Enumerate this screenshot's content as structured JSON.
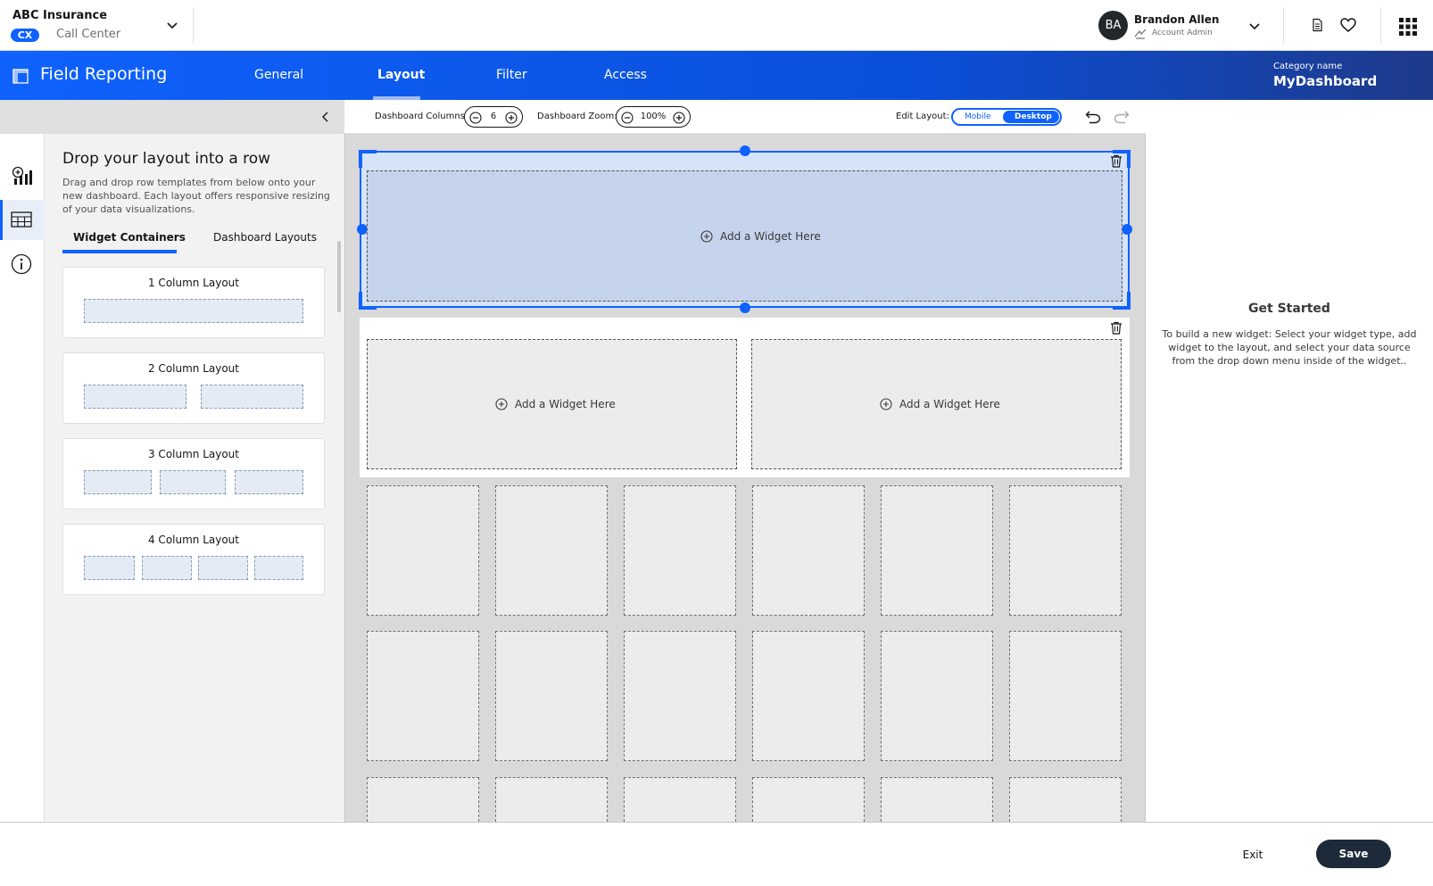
{
  "org": {
    "name": "ABC Insurance",
    "badge": "CX",
    "subtitle": "Call Center"
  },
  "user": {
    "initials": "BA",
    "name": "Brandon Allen",
    "role": "Account Admin"
  },
  "header": {
    "title": "Field Reporting",
    "tabs": [
      {
        "label": "General",
        "active": false
      },
      {
        "label": "Layout",
        "active": true
      },
      {
        "label": "Filter",
        "active": false
      },
      {
        "label": "Access",
        "active": false
      }
    ],
    "category_label": "Category name",
    "category_value": "MyDashboard"
  },
  "rail": {
    "items": [
      {
        "icon": "add-chart-icon",
        "active": false
      },
      {
        "icon": "table-layout-icon",
        "active": true
      },
      {
        "icon": "info-icon",
        "active": false
      }
    ]
  },
  "panel": {
    "title": "Drop your layout into a row",
    "description": "Drag and drop row templates from below onto your new dashboard. Each layout offers responsive resizing of your data visualizations.",
    "tabs": [
      {
        "label": "Widget Containers",
        "active": true
      },
      {
        "label": "Dashboard Layouts",
        "active": false
      }
    ],
    "layouts": [
      {
        "label": "1 Column Layout",
        "columns": 1
      },
      {
        "label": "2 Column Layout",
        "columns": 2
      },
      {
        "label": "3 Column Layout",
        "columns": 3
      },
      {
        "label": "4 Column Layout",
        "columns": 4
      }
    ]
  },
  "toolbar": {
    "columns_label": "Dashboard Columns:",
    "columns_value": "6",
    "zoom_label": "Dashboard Zoom:",
    "zoom_value": "100%",
    "edit_layout_label": "Edit Layout:",
    "mobile_label": "Mobile",
    "desktop_label": "Desktop",
    "selected_mode": "Desktop"
  },
  "canvas": {
    "add_widget_label": "Add a Widget Here",
    "grid_columns": 6
  },
  "right_panel": {
    "title": "Get Started",
    "text": "To build a new widget: Select your widget type, add widget to the layout, and select your data source from the drop down menu inside of the widget.."
  },
  "footer": {
    "exit_label": "Exit",
    "save_label": "Save"
  },
  "colors": {
    "primary": "#0f62fe",
    "save_button": "#1c2a3a",
    "selection_fill": "#d6e4fb"
  }
}
